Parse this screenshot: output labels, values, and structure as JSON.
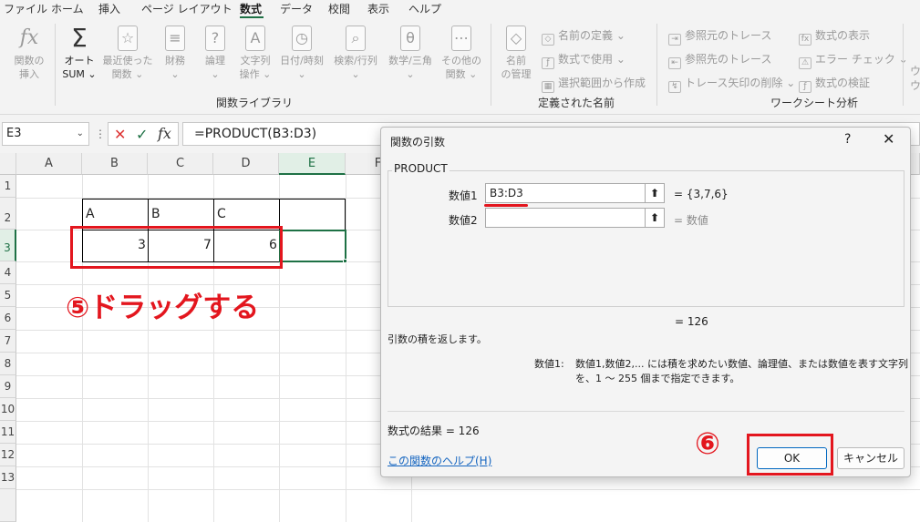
{
  "menu": {
    "tabs": [
      "ファイル",
      "ホーム",
      "挿入",
      "ページ レイアウト",
      "数式",
      "データ",
      "校閲",
      "表示",
      "ヘルプ"
    ],
    "active": "数式"
  },
  "ribbon": {
    "insert_function": {
      "icon": "fx",
      "label1": "関数の",
      "label2": "挿入"
    },
    "autosum": {
      "icon": "Σ",
      "label1": "オート",
      "label2": "SUM ⌄"
    },
    "recent": {
      "label1": "最近使った",
      "label2": "関数 ⌄"
    },
    "financial": {
      "label1": "財務",
      "label2": "⌄"
    },
    "logical": {
      "label1": "論理",
      "label2": "⌄"
    },
    "text": {
      "label1": "文字列",
      "label2": "操作 ⌄"
    },
    "datetime": {
      "label1": "日付/時刻",
      "label2": "⌄"
    },
    "lookup": {
      "label1": "検索/行列",
      "label2": "⌄"
    },
    "math": {
      "label1": "数学/三角",
      "label2": "⌄"
    },
    "more": {
      "label1": "その他の",
      "label2": "関数 ⌄"
    },
    "library_label": "関数ライブラリ",
    "name_manager": {
      "label1": "名前",
      "label2": "の管理"
    },
    "define_name": "名前の定義 ⌄",
    "use_in_formula": "数式で使用 ⌄",
    "create_from_selection": "選択範囲から作成",
    "defined_names_label": "定義された名前",
    "trace_precedents": "参照元のトレース",
    "trace_dependents": "参照先のトレース",
    "remove_arrows": "トレース矢印の削除 ⌄",
    "show_formulas": "数式の表示",
    "error_checking": "エラー チェック ⌄",
    "evaluate_formula": "数式の検証",
    "auditing_label": "ワークシート分析",
    "watch": {
      "label1": "ウ",
      "label2": "ウ"
    }
  },
  "formula_bar": {
    "name_box": "E3",
    "cancel": "✕",
    "enter": "✓",
    "fx": "fx",
    "formula": "=PRODUCT(B3:D3)"
  },
  "sheet": {
    "columns": [
      "A",
      "B",
      "C",
      "D",
      "E",
      "F"
    ],
    "rows": [
      "1",
      "2",
      "3",
      "4",
      "5",
      "6",
      "7",
      "8",
      "9",
      "10",
      "11",
      "12",
      "13"
    ],
    "headers": {
      "B2": "A",
      "C2": "B",
      "D2": "C"
    },
    "values": {
      "B3": "3",
      "C3": "7",
      "D3": "6"
    }
  },
  "annotations": {
    "step5": "⑤ドラッグする",
    "step6": "⑥",
    "accent_color": "#e3161e"
  },
  "dialog": {
    "title": "関数の引数",
    "help": "?",
    "close": "✕",
    "function_name": "PRODUCT",
    "arg1_label": "数値1",
    "arg1_value": "B3:D3",
    "arg1_result": "=  {3,7,6}",
    "arg2_label": "数値2",
    "arg2_value": "",
    "arg2_result": "=  数値",
    "collapse_icon": "⬆",
    "total": "=   126",
    "description": "引数の積を返します。",
    "arg_help_label": "数値1:",
    "arg_help_line1": "数値1,数値2,... には積を求めたい数値、論理値、または数値を表す文字列",
    "arg_help_line2": "を、1 ～ 255 個まで指定できます。",
    "result_label": "数式の結果 =   126",
    "help_link": "この関数のヘルプ(H)",
    "ok": "OK",
    "cancel": "キャンセル"
  }
}
